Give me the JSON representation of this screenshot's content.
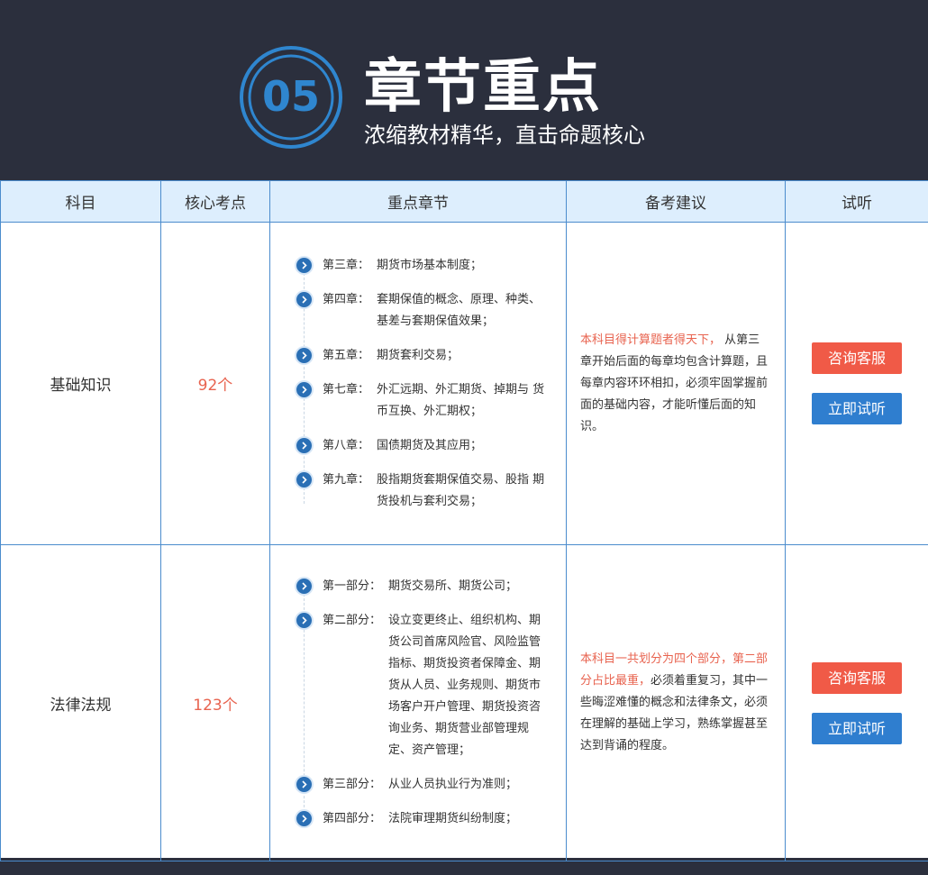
{
  "header": {
    "badge_number": "05",
    "title": "章节重点",
    "subtitle": "浓缩教材精华，直击命题核心"
  },
  "table": {
    "columns": [
      "科目",
      "核心考点",
      "重点章节",
      "备考建议",
      "试听"
    ],
    "rows": [
      {
        "subject": "基础知识",
        "points": "92个",
        "chapters": [
          {
            "label": "第三章：",
            "text": "期货市场基本制度；"
          },
          {
            "label": "第四章：",
            "text": "套期保值的概念、原理、种类、 基差与套期保值效果；"
          },
          {
            "label": "第五章：",
            "text": "期货套利交易；"
          },
          {
            "label": "第七章：",
            "text": "外汇远期、外汇期货、掉期与 货币互换、外汇期权；"
          },
          {
            "label": "第八章：",
            "text": "国债期货及其应用；"
          },
          {
            "label": "第九章：",
            "text": "股指期货套期保值交易、股指 期货投机与套利交易；"
          }
        ],
        "advice_highlight": "本科目得计算题者得天下，",
        "advice_text": "从第三章开始后面的每章均包含计算题，且每章内容环环相扣，必须牢固掌握前面的基础内容，才能听懂后面的知识。",
        "consult_label": "咨询客服",
        "listen_label": "立即试听"
      },
      {
        "subject": "法律法规",
        "points": "123个",
        "chapters": [
          {
            "label": "第一部分：",
            "text": "期货交易所、期货公司；"
          },
          {
            "label": "第二部分：",
            "text": "设立变更终止、组织机构、期货公司首席风险官、风险监管指标、期货投资者保障金、期货从人员、业务规则、期货市场客户开户管理、期货投资咨询业务、期货营业部管理规定、资产管理；"
          },
          {
            "label": "第三部分：",
            "text": "从业人员执业行为准则；"
          },
          {
            "label": "第四部分：",
            "text": "法院审理期货纠纷制度；"
          }
        ],
        "advice_highlight": "本科目一共划分为四个部分，第二部分占比最重，",
        "advice_text": "必须着重复习，其中一些晦涩难懂的概念和法律条文，必须在理解的基础上学习，熟练掌握甚至达到背诵的程度。",
        "consult_label": "咨询客服",
        "listen_label": "立即试听"
      }
    ]
  },
  "colors": {
    "background": "#2b2f3d",
    "accent_blue": "#2f7ecf",
    "accent_red": "#f05a47",
    "highlight_text": "#e8634f"
  }
}
